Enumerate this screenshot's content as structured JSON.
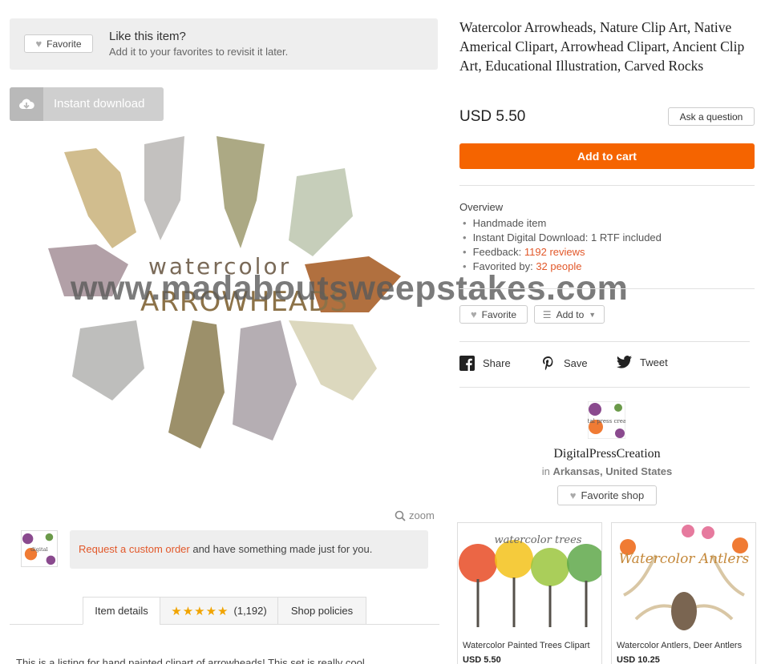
{
  "favorite_banner": {
    "button_label": "Favorite",
    "title": "Like this item?",
    "subtitle": "Add it to your favorites to revisit it later."
  },
  "instant_download": {
    "label": "Instant download"
  },
  "product_image": {
    "line1": "watercolor",
    "line2": "ARROWHEADS"
  },
  "zoom_label": "zoom",
  "watermark": "www.madaboutsweepstakes.com",
  "custom_order": {
    "link_text": "Request a custom order",
    "rest_text": " and have something made just for you."
  },
  "tabs": {
    "item_details": "Item details",
    "reviews_count": "(1,192)",
    "shop_policies": "Shop policies"
  },
  "description_snippet": "This is a listing for hand painted clipart of arrowheads! This set is really cool",
  "listing": {
    "title": "Watercolor Arrowheads, Nature Clip Art, Native Americal Clipart, Arrowhead Clipart, Ancient Clip Art, Educational Illustration, Carved Rocks",
    "price": "USD 5.50",
    "ask_label": "Ask a question",
    "cart_label": "Add to cart"
  },
  "overview": {
    "heading": "Overview",
    "handmade": "Handmade item",
    "download": "Instant Digital Download: 1 RTF included",
    "feedback_label": "Feedback: ",
    "feedback_value": "1192 reviews",
    "favorited_label": "Favorited by: ",
    "favorited_value": "32 people"
  },
  "actions": {
    "favorite": "Favorite",
    "add_to": "Add to"
  },
  "share": {
    "facebook": "Share",
    "pinterest": "Save",
    "twitter": "Tweet"
  },
  "shop": {
    "logo_text": "digital press creation",
    "name": "DigitalPressCreation",
    "in": "in ",
    "location": "Arkansas, United States",
    "favorite_shop": "Favorite shop"
  },
  "related": [
    {
      "image_text": "watercolor trees",
      "title": "Watercolor Painted Trees Clipart",
      "price": "USD 5.50"
    },
    {
      "image_text": "Watercolor Antlers",
      "title": "Watercolor Antlers, Deer Antlers",
      "price": "USD 10.25"
    }
  ],
  "colors": {
    "accent": "#f56400",
    "link": "#e2582a",
    "star": "#f1a400"
  }
}
